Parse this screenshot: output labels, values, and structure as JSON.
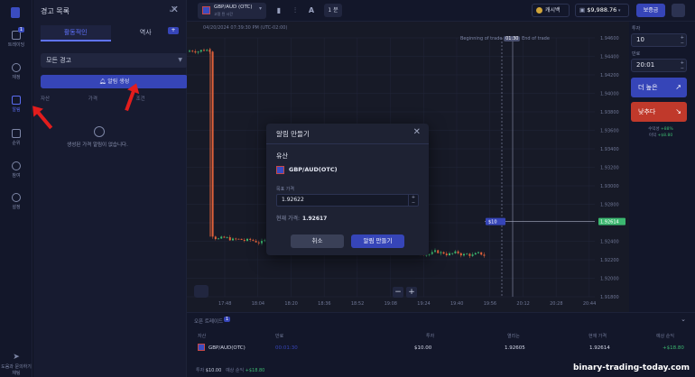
{
  "nav": {
    "items": [
      {
        "label": "트레이딩",
        "badge": "1"
      },
      {
        "label": "재정"
      },
      {
        "label": "알림"
      },
      {
        "label": "순위"
      },
      {
        "label": "참여"
      },
      {
        "label": "설정"
      }
    ],
    "help_label": "도움과 문의하기 채팅"
  },
  "panel": {
    "title": "경고 목록",
    "tabs": [
      "활동적인",
      "역사"
    ],
    "filter_value": "모든 경고",
    "create_button": "알림 생성",
    "columns": [
      "자산",
      "가격",
      "조건"
    ],
    "empty_message": "생성된 가격 알림이 없습니다.",
    "add_tag": "+"
  },
  "topbar": {
    "asset_name": "GBP/AUD (OTC)",
    "asset_sub": "고정 된 시간",
    "timeframe": "1 분",
    "cashier_label": "캐시백",
    "balance": "$9,988.76",
    "deposit_label": "보증금"
  },
  "chart_header": {
    "date": "04/20/2024 07:39:30 PM  (UTC-02:00)",
    "beginning_label": "Beginning of trade",
    "countdown": "01:30",
    "end_label": "End of trade"
  },
  "chart_data": {
    "type": "candlestick",
    "y_ticks": [
      "1.94600",
      "1.94400",
      "1.94200",
      "1.94000",
      "1.93800",
      "1.93600",
      "1.93400",
      "1.93200",
      "1.93000",
      "1.92800",
      "1.92600",
      "1.92400",
      "1.92200",
      "1.92000",
      "1.91800"
    ],
    "x_ticks": [
      "17:48",
      "18:04",
      "18:20",
      "18:36",
      "18:52",
      "19:08",
      "19:24",
      "19:40",
      "19:56",
      "20:12",
      "20:28",
      "20:44"
    ],
    "current_price": "1.92614",
    "trade_marker": "$10"
  },
  "trade_panel": {
    "amount_label": "투자",
    "amount": "10",
    "time_label": "만료",
    "time": "20:01",
    "up_label": "더 높은",
    "down_label": "낮추다",
    "payout_label": "수익성",
    "payout_value": "+88%",
    "profit_label": "이익",
    "profit_value": "+$8.80"
  },
  "trades": {
    "tab_label": "오픈 트레이드",
    "badge": "1",
    "headers": [
      "자산",
      "만료",
      "투자",
      "열리는",
      "현재 가격",
      "예상 순익"
    ],
    "row": {
      "asset": "GBP/AUD(OTC)",
      "expiry": "00:01:30",
      "amount": "$10.00",
      "open_price": "1.92605",
      "current_price": "1.92614",
      "profit": "+$18.80"
    },
    "footer_invest_label": "투자",
    "footer_invest": "$10.00",
    "footer_profit_label": "예상 순익",
    "footer_profit": "+$18.80"
  },
  "modal": {
    "title": "알림 만들기",
    "section": "유산",
    "asset": "GBP/AUD(OTC)",
    "target_label": "목표 가격",
    "target_value": "1.92622",
    "current_label": "현재 가격:",
    "current_value": "1.92617",
    "cancel_label": "취소",
    "ok_label": "알림 만들기"
  },
  "watermark": "binary-trading-today.com"
}
